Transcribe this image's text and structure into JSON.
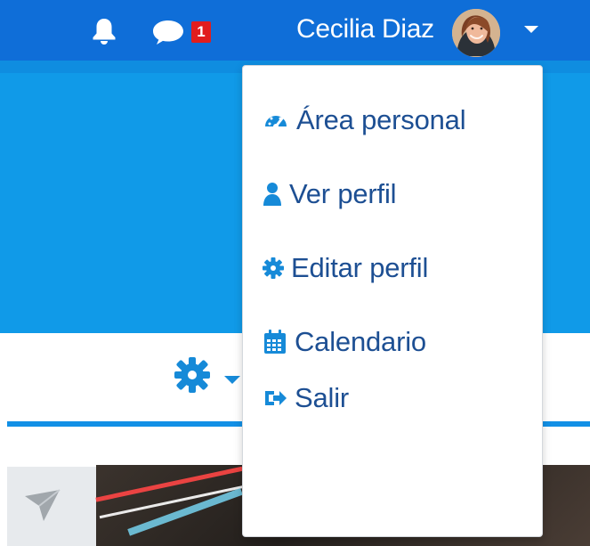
{
  "header": {
    "notifications_icon": "bell-icon",
    "messages_icon": "chat-bubble-icon",
    "message_count": "1",
    "user_name": "Cecilia Diaz",
    "avatar_icon": "profile-photo",
    "menu_toggle_icon": "caret-down-icon",
    "colors": {
      "top_bar": "#0f6ed8",
      "band": "#109ae8",
      "badge": "#e11d1d",
      "menu_text": "#1d4f93",
      "menu_icon": "#168ad8"
    }
  },
  "page": {
    "settings_icon": "gear-icon",
    "settings_caret_icon": "caret-down-icon",
    "background_icon": "send-icon"
  },
  "user_menu": {
    "items": [
      {
        "label": "Área personal",
        "icon": "dashboard-icon"
      },
      {
        "label": "Ver perfil",
        "icon": "user-icon"
      },
      {
        "label": "Editar perfil",
        "icon": "gear-icon"
      },
      {
        "label": "Calendario",
        "icon": "calendar-icon"
      },
      {
        "label": "Salir",
        "icon": "sign-out-icon"
      }
    ]
  }
}
